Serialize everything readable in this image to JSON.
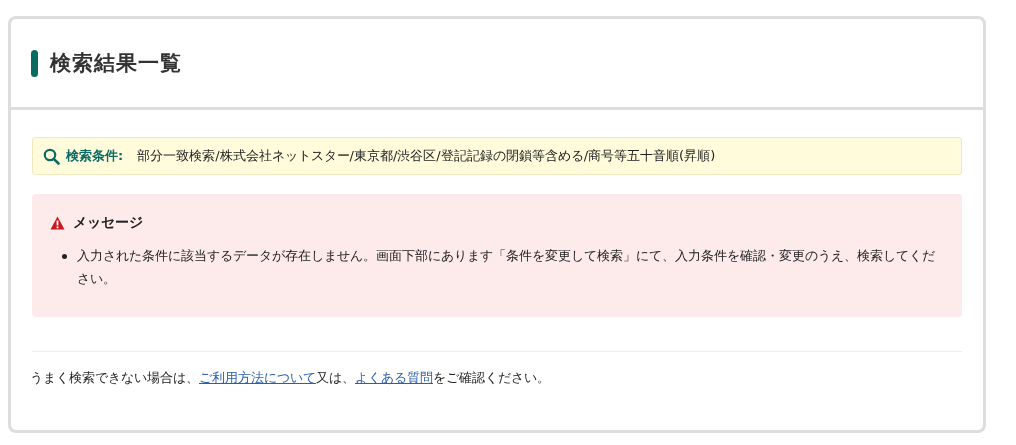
{
  "title": "検索結果一覧",
  "search_conditions": {
    "label": "検索条件:",
    "value": "部分一致検索/株式会社ネットスター/東京都/渋谷区/登記記録の閉鎖等含める/商号等五十音順(昇順)"
  },
  "message": {
    "title": "メッセージ",
    "items": [
      "入力された条件に該当するデータが存在しません。画面下部にあります「条件を変更して検索」にて、入力条件を確認・変更のうえ、検索してください。"
    ]
  },
  "help": {
    "parts": [
      {
        "kind": "text",
        "text": "うまく検索できない場合は、"
      },
      {
        "kind": "link",
        "text": "ご利用方法について"
      },
      {
        "kind": "text",
        "text": "又は、"
      },
      {
        "kind": "link",
        "text": "よくある質問"
      },
      {
        "kind": "text",
        "text": "をご確認ください。"
      }
    ]
  }
}
